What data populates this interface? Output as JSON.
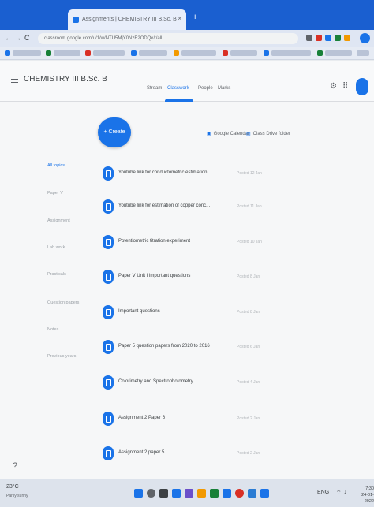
{
  "browser": {
    "tab_title": "Assignments | CHEMISTRY III B.Sc. B",
    "tab_close": "×",
    "new_tab": "+",
    "nav_back": "←",
    "nav_forward": "→",
    "nav_reload": "C",
    "url": "classroom.google.com/u/1/w/NTU5MjY0NzE2ODQx/t/all"
  },
  "classroom": {
    "title": "CHEMISTRY III B.Sc. B",
    "tabs": [
      {
        "label": "Stream"
      },
      {
        "label": "Classwork"
      },
      {
        "label": "People"
      },
      {
        "label": "Marks"
      }
    ],
    "create_label": "+ Create",
    "calendar_link": "Google Calendar",
    "drive_link": "Class Drive folder",
    "topics": [
      {
        "label": "All topics"
      },
      {
        "label": "Paper V"
      },
      {
        "label": "Assignment"
      },
      {
        "label": "Lab work"
      },
      {
        "label": "Practicals"
      },
      {
        "label": "Question papers"
      },
      {
        "label": "Notes"
      },
      {
        "label": "Previous years"
      }
    ],
    "assignments": [
      {
        "title": "Youtube link for conductometric estimation...",
        "date": "Posted 12 Jan"
      },
      {
        "title": "Youtube link for estimation of copper conc...",
        "date": "Posted 11 Jan"
      },
      {
        "title": "Potentiometric titration experiment",
        "date": "Posted 10 Jan"
      },
      {
        "title": "Paper V Unit I important questions",
        "date": "Posted 8 Jan"
      },
      {
        "title": "Important questions",
        "date": "Posted 8 Jan"
      },
      {
        "title": "Paper 5 question papers from 2020 to 2016",
        "date": "Posted 6 Jan"
      },
      {
        "title": "Colorimetry and Spectrophotometry",
        "date": "Posted 4 Jan"
      },
      {
        "title": "Assignment 2 Paper 6",
        "date": "Posted 2 Jan"
      },
      {
        "title": "Assignment 2 paper 5",
        "date": "Posted 2 Jan"
      }
    ]
  },
  "taskbar": {
    "weather_temp": "23°C",
    "weather_desc": "Partly sunny",
    "tray_text": "ENG",
    "time": "7:30",
    "date": "24-01-2022"
  },
  "colors": {
    "accent": "#1a73e8",
    "chrome": "#1a5fd0"
  }
}
